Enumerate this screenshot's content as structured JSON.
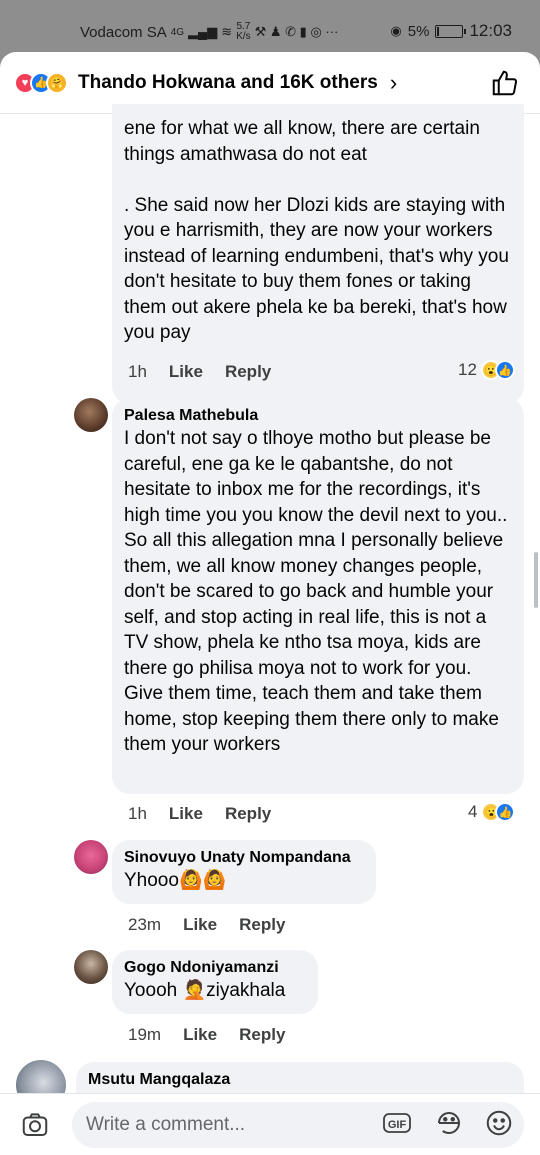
{
  "status_bar": {
    "carrier": "Vodacom SA",
    "network": "4G",
    "speed": "5.7\nK/s",
    "battery": "5%",
    "battery_level": 0.05,
    "time": "12:03"
  },
  "header": {
    "reaction_icons": [
      "heart-icon",
      "like-icon",
      "care-icon"
    ],
    "title": "Thando Hokwana and 16K others"
  },
  "comments": [
    {
      "author": "",
      "text": "ene for what we all know, there are certain things amathwasa do not eat\n\n. She said now her Dlozi kids are staying with you e harrismith, they are now your workers instead of learning endumbeni, that's why you don't hesitate to buy them fones or taking them out akere phela ke ba bereki, that's how you pay",
      "time": "1h",
      "like": "Like",
      "reply": "Reply",
      "reactions": "12"
    },
    {
      "author": "Palesa Mathebula",
      "text": "I don't not say o tlhoye motho but please be careful, ene ga ke le qabantshe, do not hesitate to inbox me for the recordings, it's high time you you know the devil next to you.. So all this allegation mna I personally believe them, we all know money changes people, don't be scared to go back and humble your self, and stop acting in real life, this is not a TV show, phela ke ntho tsa moya, kids are there go philisa moya not to work for you. Give them time, teach them and take them home, stop keeping them there only to make them your workers",
      "time": "1h",
      "like": "Like",
      "reply": "Reply",
      "reactions": "4"
    },
    {
      "author": "Sinovuyo Unaty Nompandana",
      "text": "Yhooo🙆🙆",
      "time": "23m",
      "like": "Like",
      "reply": "Reply"
    },
    {
      "author": "Gogo Ndoniyamanzi",
      "text": "Yoooh 🤦ziyakhala",
      "time": "19m",
      "like": "Like",
      "reply": "Reply"
    },
    {
      "author": "Msutu Mangqalaza",
      "text": ""
    }
  ],
  "composer": {
    "placeholder": "Write a comment...",
    "gif_label": "GIF"
  },
  "colors": {
    "bubble": "#f0f2f5",
    "like_blue": "#1877f2",
    "heart_red": "#f33e58",
    "status_gray": "#8e8e8e"
  }
}
